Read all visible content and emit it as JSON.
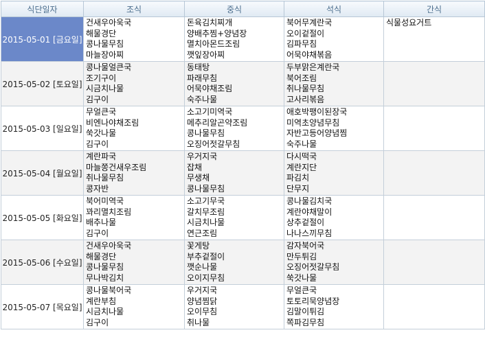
{
  "headers": [
    "식단일자",
    "조식",
    "중식",
    "석식",
    "간식"
  ],
  "rows": [
    {
      "date": "2015-05-01 [금요일]",
      "breakfast": [
        "건새우아욱국",
        "해물경단",
        "콩나물무침",
        "마늘장아찌"
      ],
      "lunch": [
        "돈육김치찌개",
        "양배추찜+양념장",
        "멸치아몬드조림",
        "깻잎장아찌"
      ],
      "dinner": [
        "북어무계란국",
        "오이겉절이",
        "김파무침",
        "어묵야채볶음"
      ],
      "snack": [
        "식물성요거트"
      ]
    },
    {
      "date": "2015-05-02 [토요일]",
      "breakfast": [
        "콩나물얼큰국",
        "조기구이",
        "시금치나물",
        "김구이"
      ],
      "lunch": [
        "동태탕",
        "파래무침",
        "어묵야채조림",
        "숙주나물"
      ],
      "dinner": [
        "두부맑은계란국",
        "북어조림",
        "취나물무침",
        "고사리볶음"
      ],
      "snack": []
    },
    {
      "date": "2015-05-03 [일요일]",
      "breakfast": [
        "무얼큰국",
        "비엔나야채조림",
        "쑥갓나물",
        "김구이"
      ],
      "lunch": [
        "소고기미역국",
        "메추리알곤약조림",
        "콩나물무침",
        "오징어젓갈무침"
      ],
      "dinner": [
        "애호박팽이된장국",
        "미역초양념무침",
        "자반고등어양념찜",
        "숙주나물"
      ],
      "snack": []
    },
    {
      "date": "2015-05-04 [월요일]",
      "breakfast": [
        "계란파국",
        "마늘쫑건새우조림",
        "취나물무침",
        "콩자반"
      ],
      "lunch": [
        "우거지국",
        "잡채",
        "무생채",
        "콩나물무침"
      ],
      "dinner": [
        "다시떡국",
        "계란지단",
        "파김치",
        "단무지"
      ],
      "snack": []
    },
    {
      "date": "2015-05-05 [화요일]",
      "breakfast": [
        "북어미역국",
        "꽈리멸치조림",
        "배추나물",
        "김구이"
      ],
      "lunch": [
        "소고기무국",
        "갈치무조림",
        "시금치나물",
        "연근조림"
      ],
      "dinner": [
        "콩나물김치국",
        "계란야채말이",
        "상추겉절이",
        "나나스끼무침"
      ],
      "snack": []
    },
    {
      "date": "2015-05-06 [수요일]",
      "breakfast": [
        "건새우아욱국",
        "해물경단",
        "콩나물무침",
        "무나박김치"
      ],
      "lunch": [
        "꽃게탕",
        "부추겉절이",
        "깻순나물",
        "오이지무침"
      ],
      "dinner": [
        "감자북어국",
        "만두튀김",
        "오징어젓갈무침",
        "쑥갓나물"
      ],
      "snack": []
    },
    {
      "date": "2015-05-07 [목요일]",
      "breakfast": [
        "콩나물북어국",
        "계란부침",
        "시금치나물",
        "김구이"
      ],
      "lunch": [
        "우거지국",
        "양념찜닭",
        "오이무침",
        "취나물"
      ],
      "dinner": [
        "무얼큰국",
        "토토리묵양념장",
        "김말이튀김",
        "쪽파김무침"
      ],
      "snack": []
    }
  ]
}
